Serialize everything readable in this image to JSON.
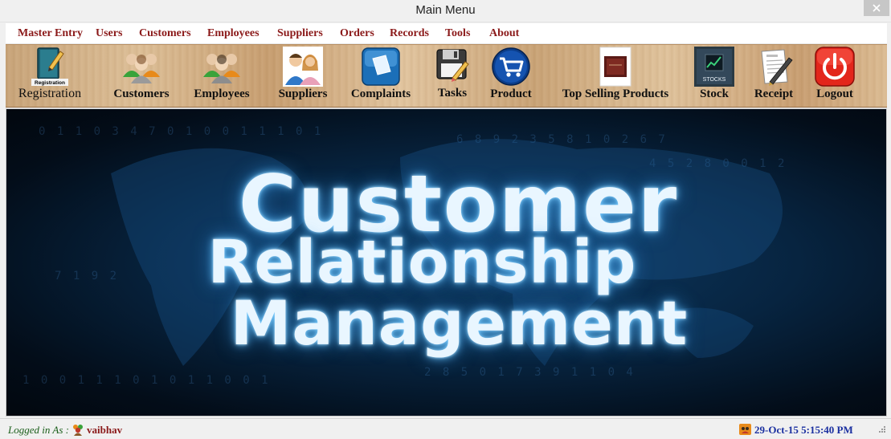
{
  "window": {
    "title": "Main Menu"
  },
  "menu": [
    "Master Entry",
    "Users",
    "Customers",
    "Employees",
    "Suppliers",
    "Orders",
    "Records",
    "Tools",
    "About"
  ],
  "toolbar": [
    {
      "label": "Registration",
      "icon": "registration-book-icon",
      "icon_text": "Registration"
    },
    {
      "label": "Customers",
      "icon": "customers-group-icon"
    },
    {
      "label": "Employees",
      "icon": "employees-group-icon"
    },
    {
      "label": "Suppliers",
      "icon": "suppliers-people-icon"
    },
    {
      "label": "Complaints",
      "icon": "complaints-icon"
    },
    {
      "label": "Tasks",
      "icon": "floppy-disk-icon"
    },
    {
      "label": "Product",
      "icon": "shopping-cart-icon"
    },
    {
      "label": "Top Selling Products",
      "icon": "top-products-icon"
    },
    {
      "label": "Stock",
      "icon": "stock-chart-icon",
      "icon_text": "STOCKS"
    },
    {
      "label": "Receipt",
      "icon": "receipt-icon"
    },
    {
      "label": "Logout",
      "icon": "power-icon"
    }
  ],
  "banner": {
    "line1": "Customer",
    "line2": "Relationship",
    "line3": "Management"
  },
  "status": {
    "logged_label": "Logged in As :",
    "user": "vaibhav",
    "datetime": "29-Oct-15 5:15:40 PM"
  },
  "colors": {
    "menu_text": "#8b1a1a",
    "banner_glow": "#6ec8ff",
    "status_user": "#8b1a1a",
    "status_datetime": "#1a2fa0",
    "logout_red": "#e3261b"
  }
}
